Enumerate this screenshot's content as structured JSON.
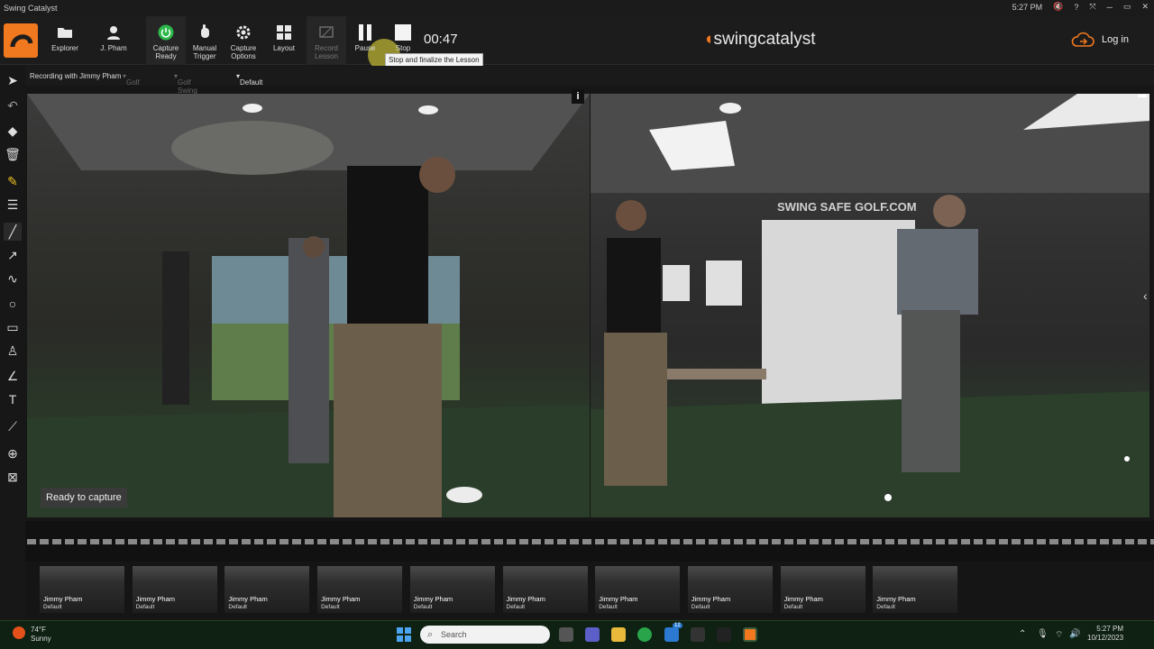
{
  "window": {
    "title": "Swing Catalyst",
    "time": "5:27 PM",
    "controls": [
      "🔇",
      "?",
      "⤧",
      "─",
      "▭",
      "✕"
    ]
  },
  "toolbar": {
    "explorer": "Explorer",
    "user": "J. Pham",
    "capture_ready": "Capture Ready",
    "manual_trigger": "Manual Trigger",
    "capture_options": "Capture Options",
    "layout": "Layout",
    "record_lesson": "Record Lesson",
    "pause": "Pause",
    "stop": "Stop",
    "timer": "00:47",
    "brand_prefix": "swing",
    "brand_suffix": "catalyst",
    "login": "Log in",
    "tooltip": "Stop and finalize the Lesson",
    "colors": {
      "accent": "#f0781e",
      "ready_green": "#2db84a"
    }
  },
  "info": {
    "recording": "Recording with Jimmy Pham",
    "sport": "Golf",
    "activity": "Golf Swing",
    "layout": "Default"
  },
  "video": {
    "status": "Ready to capture",
    "info_badge": "i",
    "right_sign": "SWING SAFE GOLF.COM"
  },
  "thumbnails": [
    {
      "name": "Jimmy Pham",
      "layout": "Default"
    },
    {
      "name": "Jimmy Pham",
      "layout": "Default"
    },
    {
      "name": "Jimmy Pham",
      "layout": "Default"
    },
    {
      "name": "Jimmy Pham",
      "layout": "Default"
    },
    {
      "name": "Jimmy Pham",
      "layout": "Default"
    },
    {
      "name": "Jimmy Pham",
      "layout": "Default"
    },
    {
      "name": "Jimmy Pham",
      "layout": "Default"
    },
    {
      "name": "Jimmy Pham",
      "layout": "Default"
    },
    {
      "name": "Jimmy Pham",
      "layout": "Default"
    },
    {
      "name": "Jimmy Pham",
      "layout": "Default"
    }
  ],
  "taskbar": {
    "temp": "74°F",
    "weather": "Sunny",
    "search_placeholder": "Search",
    "mail_badge": "12",
    "clock_time": "5:27 PM",
    "clock_date": "10/12/2023"
  }
}
